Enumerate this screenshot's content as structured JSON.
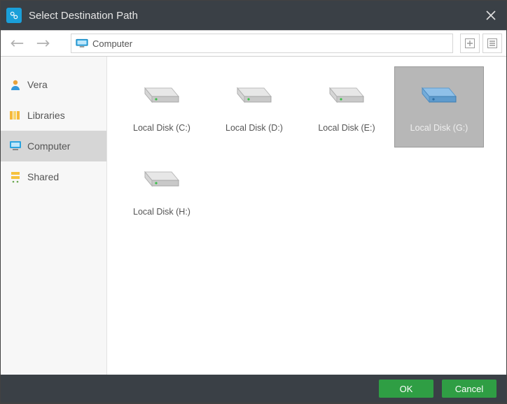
{
  "window": {
    "title": "Select Destination Path"
  },
  "nav": {
    "location_label": "Computer"
  },
  "sidebar": {
    "items": [
      {
        "label": "Vera",
        "icon": "user-icon",
        "selected": false
      },
      {
        "label": "Libraries",
        "icon": "libraries-icon",
        "selected": false
      },
      {
        "label": "Computer",
        "icon": "computer-icon",
        "selected": true
      },
      {
        "label": "Shared",
        "icon": "shared-icon",
        "selected": false
      }
    ]
  },
  "main": {
    "drives": [
      {
        "label": "Local Disk (C:)",
        "selected": false
      },
      {
        "label": "Local Disk (D:)",
        "selected": false
      },
      {
        "label": "Local Disk (E:)",
        "selected": false
      },
      {
        "label": "Local Disk (G:)",
        "selected": true
      },
      {
        "label": "Local Disk (H:)",
        "selected": false
      }
    ]
  },
  "footer": {
    "ok_label": "OK",
    "cancel_label": "Cancel"
  }
}
